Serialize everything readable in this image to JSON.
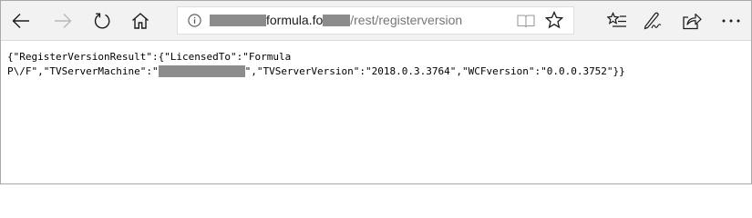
{
  "toolbar": {
    "buttons": [
      {
        "name": "back",
        "icon": "arrow-left-icon"
      },
      {
        "name": "forward",
        "icon": "arrow-right-icon"
      },
      {
        "name": "refresh",
        "icon": "refresh-icon"
      },
      {
        "name": "home",
        "icon": "home-icon"
      }
    ],
    "address": {
      "host_visible": "formula.fo",
      "path": "/rest/registerversion",
      "icon": "info-icon"
    },
    "right_buttons": [
      "reading-view-icon",
      "favorite-star-icon",
      "favorites-hub-icon",
      "web-note-icon",
      "share-icon",
      "more-icon"
    ]
  },
  "page": {
    "line1": "{\"RegisterVersionResult\":{\"LicensedTo\":\"Formula",
    "line2_start": "P\\/F\",\"TVServerMachine\":\"",
    "line2_end": "\",\"TVServerVersion\":\"2018.0.3.3764\",\"WCFversion\":\"0.0.0.3752\"}}"
  },
  "colors": {
    "toolbar_bg": "#f2f2f2",
    "icon": "#1a1a1a",
    "icon_disabled": "#b8b8b8",
    "path_text": "#767676",
    "redaction": "#8c8c8c"
  }
}
